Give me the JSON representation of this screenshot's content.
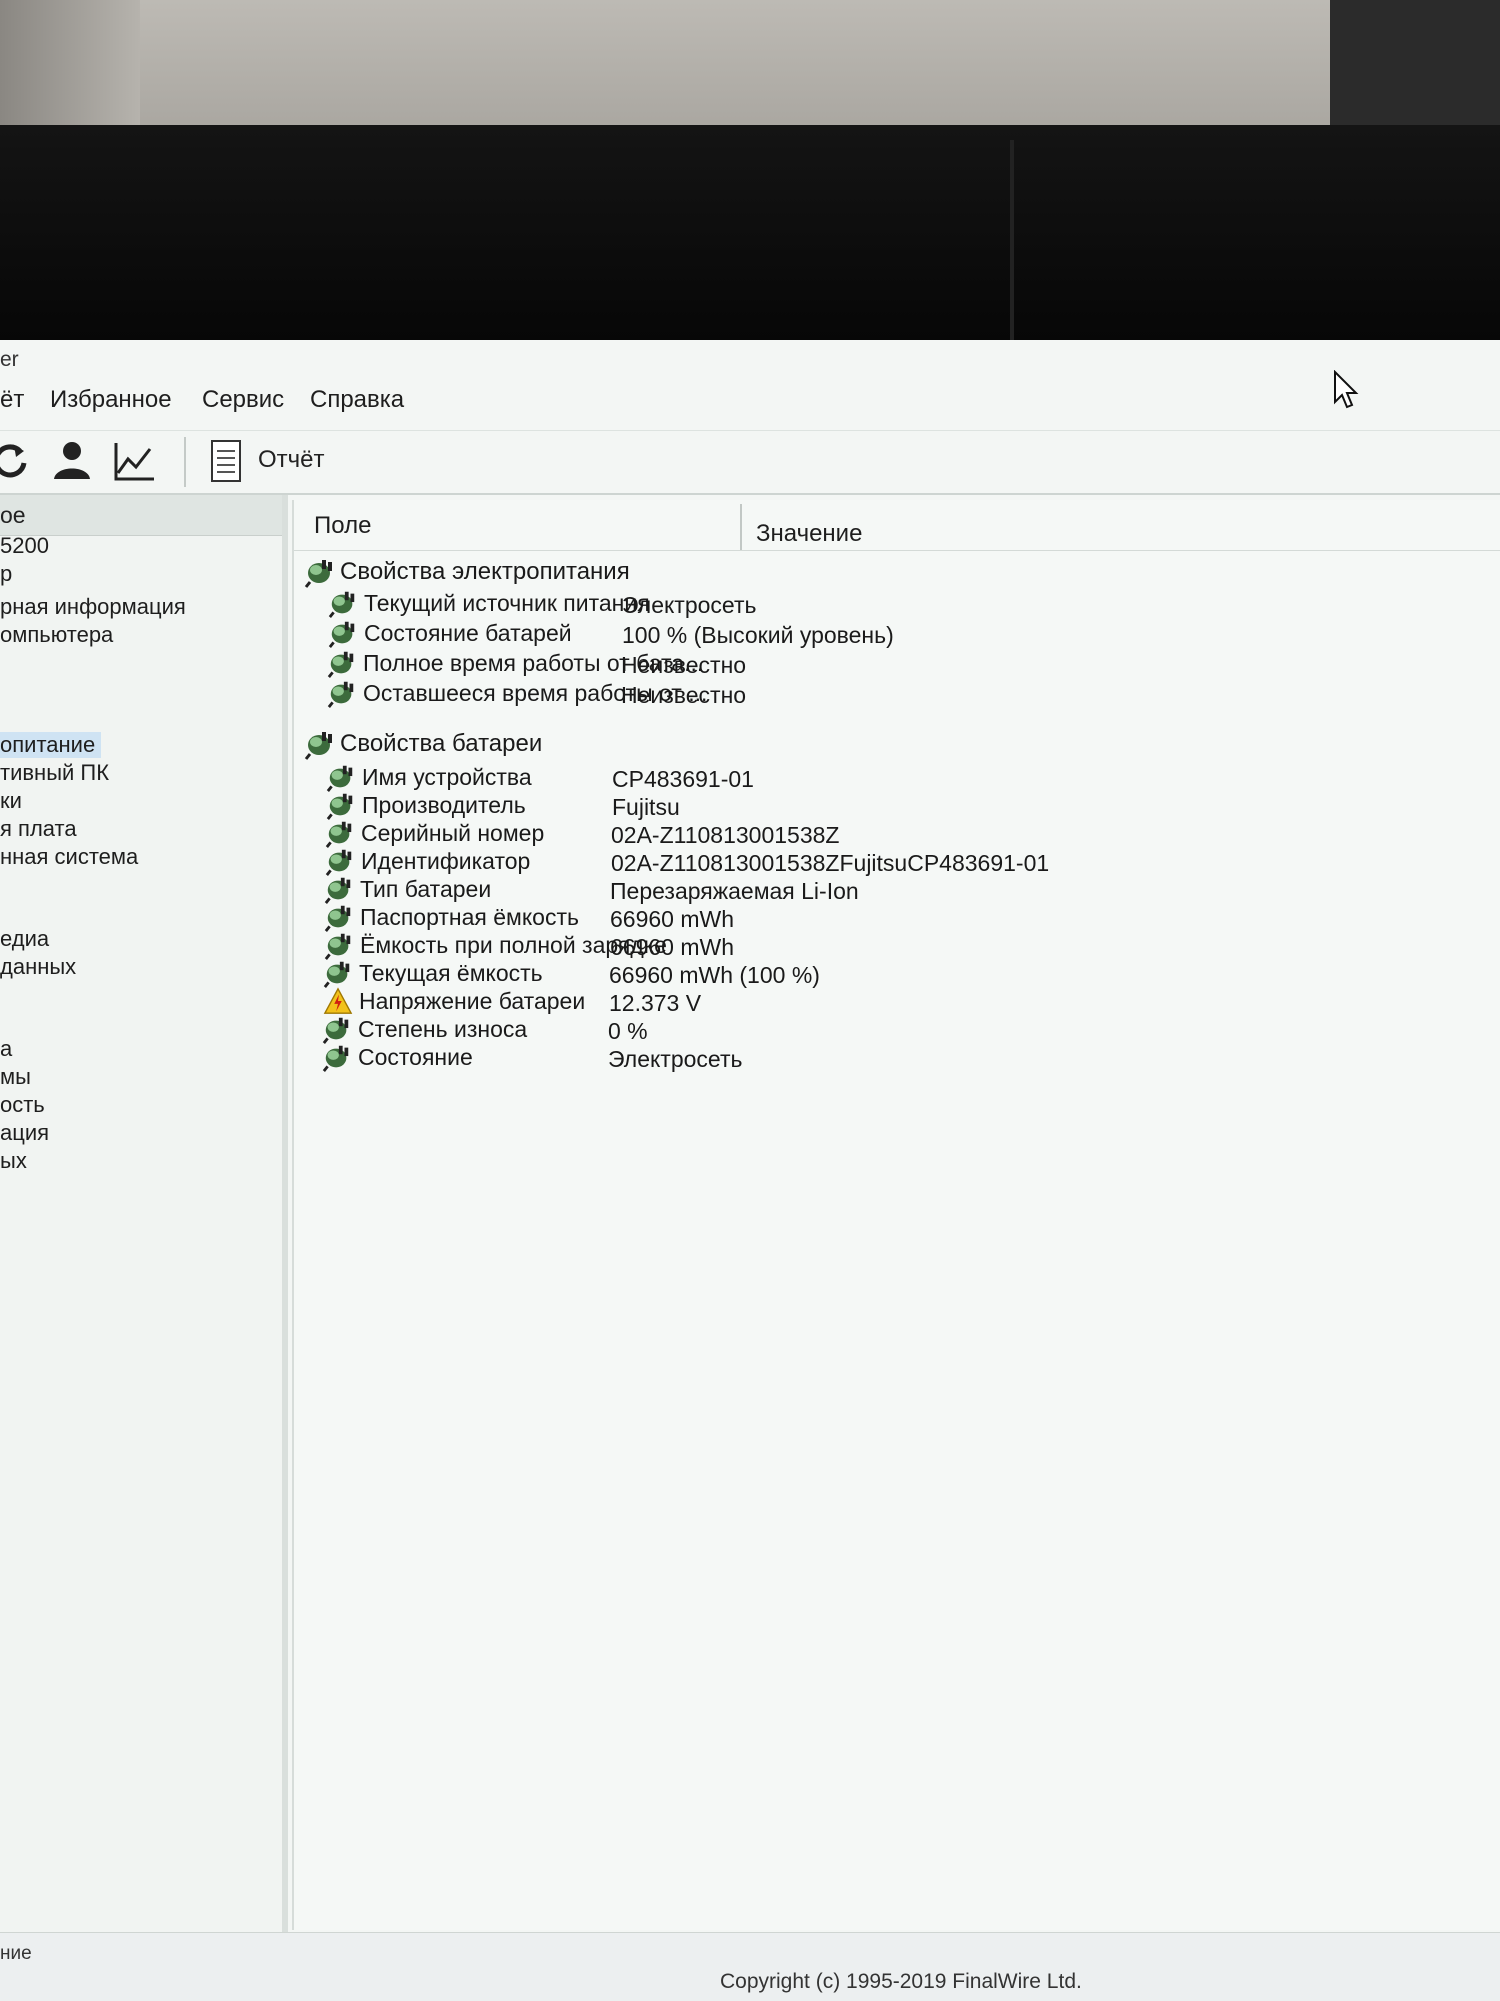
{
  "window": {
    "title_fragment": "er"
  },
  "menu": {
    "items": [
      "ёт",
      "Избранное",
      "Сервис",
      "Справка"
    ]
  },
  "toolbar": {
    "report_label": "Отчёт"
  },
  "nav": {
    "header": "ое",
    "items": [
      {
        "label": "5200"
      },
      {
        "label": "р"
      },
      {
        "label": "рная информация"
      },
      {
        "label": "омпьютера"
      },
      {
        "label": "опитание",
        "selected": true
      },
      {
        "label": "тивный ПК"
      },
      {
        "label": "ки"
      },
      {
        "label": "я плата"
      },
      {
        "label": "нная система"
      },
      {
        "label": "едиа"
      },
      {
        "label": "данных"
      },
      {
        "label": "а"
      },
      {
        "label": "мы"
      },
      {
        "label": "ость"
      },
      {
        "label": "ация"
      },
      {
        "label": "ых"
      }
    ],
    "footer": "ние"
  },
  "grid": {
    "columns": {
      "field": "Поле",
      "value": "Значение"
    },
    "groups": [
      {
        "title": "Свойства электропитания",
        "rows": [
          {
            "field": "Текущий источник питания",
            "value": "Электросеть"
          },
          {
            "field": "Состояние батарей",
            "value": "100 % (Высокий уровень)"
          },
          {
            "field": "Полное время работы от бата...",
            "value": "Неизвестно"
          },
          {
            "field": "Оставшееся время работы от ...",
            "value": "Неизвестно"
          }
        ]
      },
      {
        "title": "Свойства батареи",
        "rows": [
          {
            "field": "Имя устройства",
            "value": "CP483691-01"
          },
          {
            "field": "Производитель",
            "value": "Fujitsu"
          },
          {
            "field": "Серийный номер",
            "value": "02A-Z110813001538Z"
          },
          {
            "field": "Идентификатор",
            "value": "02A-Z110813001538ZFujitsuCP483691-01"
          },
          {
            "field": "Тип батареи",
            "value": "Перезаряжаемая Li-Ion"
          },
          {
            "field": "Паспортная ёмкость",
            "value": "66960 mWh"
          },
          {
            "field": "Ёмкость при полной зарядке",
            "value": "66960 mWh"
          },
          {
            "field": "Текущая ёмкость",
            "value": "66960 mWh  (100 %)"
          },
          {
            "field": "Напряжение батареи",
            "value": "12.373 V",
            "warning": true
          },
          {
            "field": "Степень износа",
            "value": "0 %"
          },
          {
            "field": "Состояние",
            "value": "Электросеть"
          }
        ]
      }
    ]
  },
  "copyright": "Copyright (c) 1995-2019 FinalWire Ltd.",
  "icons": {
    "refresh": "refresh-icon",
    "user": "user-icon",
    "chart": "chart-icon",
    "report": "report-document-icon",
    "power": "power-properties-icon",
    "warning": "warning-icon"
  }
}
